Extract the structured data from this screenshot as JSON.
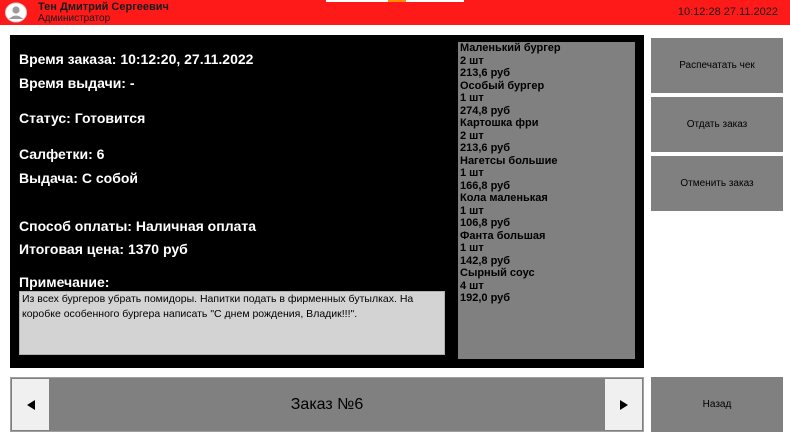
{
  "header": {
    "user_name": "Тен Дмитрий Сергеевич",
    "user_role": "Администратор",
    "clock": "10:12:28  27.11.2022",
    "accent_color": "#ff1a1a"
  },
  "order": {
    "order_time": "Время заказа: 10:12:20, 27.11.2022",
    "pickup_time": "Время выдачи: -",
    "status": "Статус: Готовится",
    "napkins": "Салфетки: 6",
    "delivery": "Выдача: С собой",
    "payment": "Способ оплаты: Наличная оплата",
    "total": "Итоговая цена: 1370 руб",
    "note_label": "Примечание:",
    "note_text": "Из всех бургеров убрать помидоры. Напитки подать в фирменных бутылках. На коробке особенного бургера написать \"С днем рождения, Владик!!!\"."
  },
  "items": [
    {
      "name": "Маленький бургер",
      "qty": "2 шт",
      "price": "213,6 руб"
    },
    {
      "name": "Особый бургер",
      "qty": "1 шт",
      "price": "274,8 руб"
    },
    {
      "name": "Картошка фри",
      "qty": "2 шт",
      "price": "213,6 руб"
    },
    {
      "name": "Нагетсы большие",
      "qty": "1 шт",
      "price": "166,8 руб"
    },
    {
      "name": "Кола маленькая",
      "qty": "1 шт",
      "price": "106,8 руб"
    },
    {
      "name": "Фанта большая",
      "qty": "1 шт",
      "price": "142,8 руб"
    },
    {
      "name": "Сырный соус",
      "qty": "4 шт",
      "price": "192,0 руб"
    }
  ],
  "actions": {
    "print_receipt": "Распечатать чек",
    "give_order": "Отдать заказ",
    "cancel_order": "Отменить заказ",
    "back": "Назад"
  },
  "nav": {
    "order_title": "Заказ №6",
    "prev_icon": "triangle-left-icon",
    "next_icon": "triangle-right-icon"
  }
}
